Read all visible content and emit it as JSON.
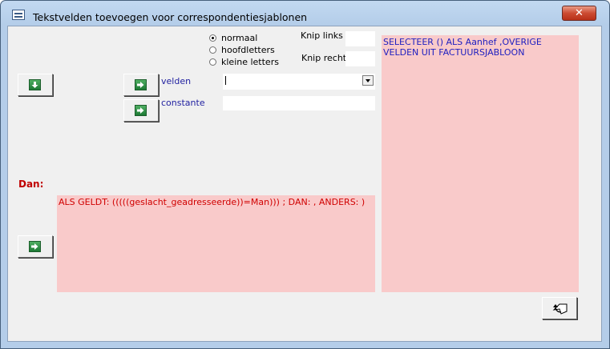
{
  "window": {
    "title": "Tekstvelden toevoegen voor correspondentiesjablonen",
    "close_symbol": "✕"
  },
  "case_options": [
    {
      "label": "normaal",
      "selected": true
    },
    {
      "label": "hoofdletters",
      "selected": false
    },
    {
      "label": "kleine letters",
      "selected": false
    }
  ],
  "knip_links": {
    "label": "Knip links",
    "value": ""
  },
  "knip_rechts": {
    "label": "Knip rechts",
    "value": ""
  },
  "velden": {
    "label": "velden",
    "value": ""
  },
  "constante": {
    "label": "constante",
    "value": ""
  },
  "dan_label": "Dan:",
  "condition_text": "ALS GELDT: (((((geslacht_geadresseerde))=Man))) ; DAN:  , ANDERS: )",
  "query_text": "SELECTEER () ALS Aanhef ,OVERIGE VELDEN UIT FACTUURSJABLOON",
  "icons": {
    "down": "arrow-down-icon",
    "right": "arrow-right-icon",
    "undo": "undo-icon",
    "window": "form-window-icon"
  },
  "colors": {
    "pink_field": "#f9caca",
    "label_blue": "#1f1fa0",
    "dan_red": "#c00000",
    "text_red": "#d00000",
    "text_blue": "#2020c0"
  }
}
